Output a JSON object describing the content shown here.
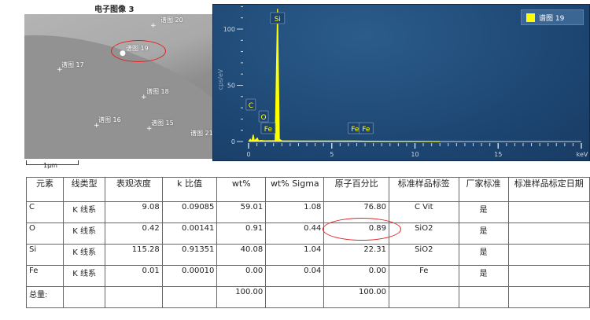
{
  "sem": {
    "title": "电子图像 3",
    "scale": "1μm",
    "spectra": [
      {
        "label": "谱图 20"
      },
      {
        "label": "谱图 19"
      },
      {
        "label": "谱图 17"
      },
      {
        "label": "谱图 18"
      },
      {
        "label": "谱图 16"
      },
      {
        "label": "谱图 15"
      },
      {
        "label": "谱图 21"
      }
    ]
  },
  "chart_data": {
    "type": "line",
    "xlabel": "keV",
    "ylabel": "cps/eV",
    "xlim": [
      0,
      20
    ],
    "ylim": [
      0,
      120
    ],
    "xticks": [
      "0",
      "5",
      "10",
      "15"
    ],
    "yticks": [
      "0",
      "50",
      "100"
    ],
    "legend": {
      "label": "谱图 19",
      "color": "#ffff00",
      "position": "top-right"
    },
    "series": [
      {
        "name": "谱图 19",
        "color": "#ffff00",
        "points": [
          [
            0.0,
            0
          ],
          [
            0.1,
            2
          ],
          [
            0.2,
            0.5
          ],
          [
            0.277,
            6
          ],
          [
            0.35,
            0.5
          ],
          [
            0.525,
            3
          ],
          [
            0.6,
            0.5
          ],
          [
            0.705,
            1
          ],
          [
            1.0,
            0.6
          ],
          [
            1.6,
            0.8
          ],
          [
            1.74,
            118
          ],
          [
            1.85,
            2
          ],
          [
            2.0,
            0.6
          ],
          [
            3,
            0.4
          ],
          [
            6.4,
            0.5
          ],
          [
            7.06,
            0.3
          ],
          [
            10,
            0.2
          ],
          [
            11.5,
            0
          ]
        ]
      }
    ],
    "peak_labels": [
      {
        "element": "C",
        "kev": 0.277
      },
      {
        "element": "O",
        "kev": 0.525
      },
      {
        "element": "Fe",
        "kev": 0.705
      },
      {
        "element": "Si",
        "kev": 1.74
      },
      {
        "element": "Fe",
        "kev": 6.4
      },
      {
        "element": "Fe",
        "kev": 7.06
      }
    ]
  },
  "table": {
    "headers": [
      "元素",
      "线类型",
      "表观浓度",
      "k 比值",
      "wt%",
      "wt% Sigma",
      "原子百分比",
      "标准样品标签",
      "厂家标准",
      "标准样品标定日期"
    ],
    "rows": [
      [
        "C",
        "K 线系",
        "9.08",
        "0.09085",
        "59.01",
        "1.08",
        "76.80",
        "C Vit",
        "是",
        ""
      ],
      [
        "O",
        "K 线系",
        "0.42",
        "0.00141",
        "0.91",
        "0.44",
        "0.89",
        "SiO2",
        "是",
        ""
      ],
      [
        "Si",
        "K 线系",
        "115.28",
        "0.91351",
        "40.08",
        "1.04",
        "22.31",
        "SiO2",
        "是",
        ""
      ],
      [
        "Fe",
        "K 线系",
        "0.01",
        "0.00010",
        "0.00",
        "0.04",
        "0.00",
        "Fe",
        "是",
        ""
      ],
      [
        "总量:",
        "",
        "",
        "",
        "100.00",
        "",
        "100.00",
        "",
        "",
        ""
      ]
    ]
  }
}
